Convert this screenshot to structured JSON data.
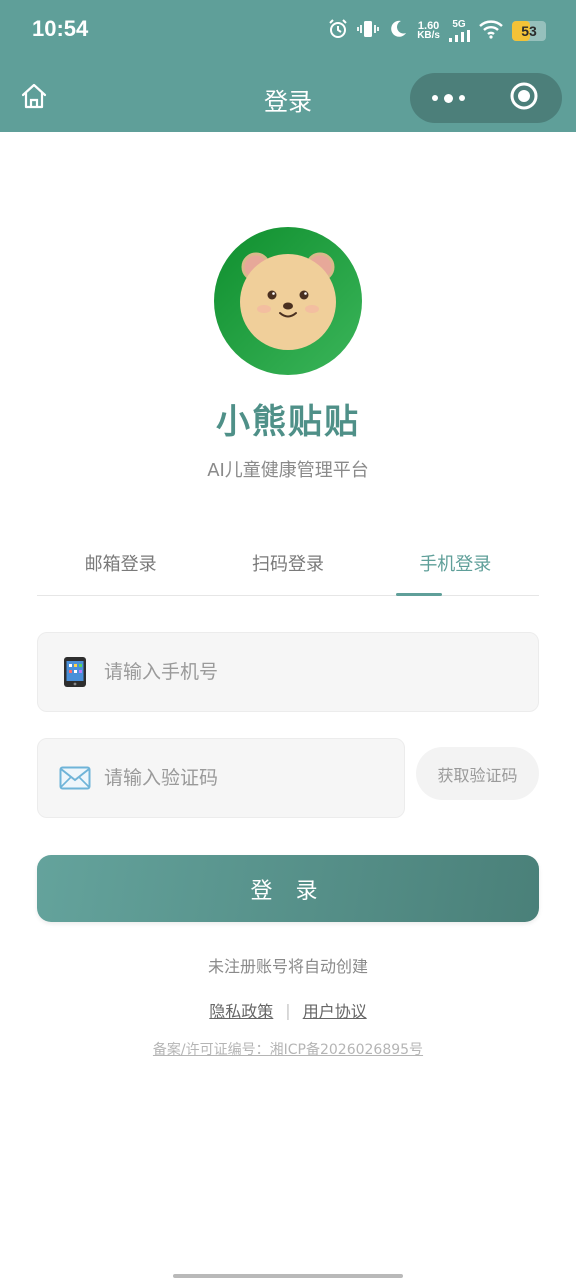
{
  "status_bar": {
    "time": "10:54",
    "net_speed_value": "1.60",
    "net_speed_unit": "KB/s",
    "network_label": "5G",
    "battery_level": "53",
    "battery_percent": 53,
    "icons": [
      "alarm-icon",
      "vibrate-icon",
      "moon-icon",
      "signal-icon",
      "wifi-icon",
      "battery-icon"
    ]
  },
  "nav": {
    "title": "登录",
    "home_icon": "home-icon",
    "more_icon": "more-dots-icon",
    "close_icon": "target-circle-icon"
  },
  "brand": {
    "name": "小熊贴贴",
    "subtitle": "AI儿童健康管理平台"
  },
  "tabs": [
    {
      "label": "邮箱登录",
      "active": false
    },
    {
      "label": "扫码登录",
      "active": false
    },
    {
      "label": "手机登录",
      "active": true
    }
  ],
  "form": {
    "phone_placeholder": "请输入手机号",
    "phone_value": "",
    "code_placeholder": "请输入验证码",
    "code_value": "",
    "get_code_label": "获取验证码",
    "login_label": "登 录"
  },
  "footer": {
    "auto_create_note": "未注册账号将自动创建",
    "privacy_label": "隐私政策",
    "separator": "|",
    "agreement_label": "用户协议",
    "icp_text": "备案/许可证编号：湘ICP备2026026895号"
  },
  "colors": {
    "primary": "#5f9f99",
    "brand_text": "#4f9088",
    "logo_green": "#1f9a3c",
    "bear_face": "#f0cf9a"
  }
}
